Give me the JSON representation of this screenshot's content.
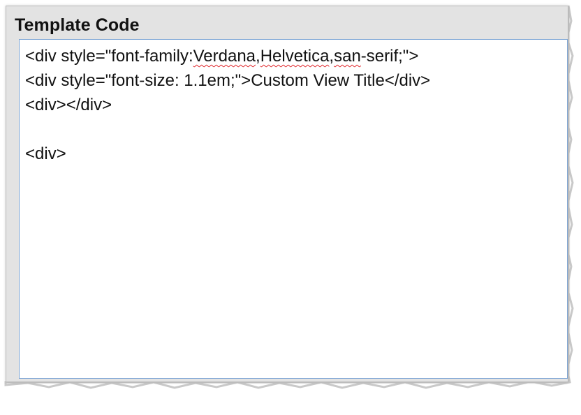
{
  "panel": {
    "title": "Template Code"
  },
  "code": {
    "line1": {
      "before": "<div style=\"font-family:",
      "w1": "Verdana",
      "sep1": ",",
      "w2": "Helvetica",
      "sep2": ",",
      "w3": "san",
      "after": "-serif;\">"
    },
    "line2": "<div style=\"font-size: 1.1em;\">Custom View Title</div>",
    "line3": "<div></div>",
    "line4": "",
    "line5": "<div>"
  },
  "colors": {
    "panel_bg": "#e3e3e3",
    "focus_border": "#7ea6d6",
    "spellcheck": "#e0262a"
  }
}
